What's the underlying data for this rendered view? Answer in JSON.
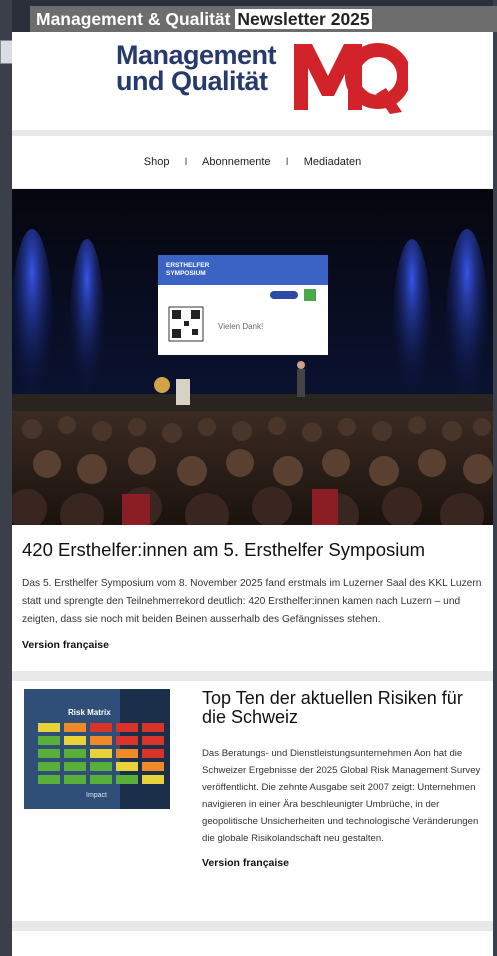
{
  "banner": {
    "title_part1": "Management & Qualität ",
    "title_part2": "Newsletter 2025"
  },
  "header": {
    "brand_line1": "Management",
    "brand_line2": "und Qualität",
    "logo_letters": "MQ"
  },
  "nav": {
    "items": [
      "Shop",
      "Abonnemente",
      "Mediadaten"
    ],
    "separator": "I"
  },
  "hero": {
    "screen_line1": "ERSTHELFER",
    "screen_line2": "SYMPOSIUM",
    "screen_thanks": "Vielen Dank!"
  },
  "article1": {
    "title": "420 Ersthelfer:innen am 5. Ersthelfer Symposium",
    "body": "Das 5. Ersthelfer Symposium vom 8. November 2025 fand erstmals im Luzerner Saal des KKL Luzern statt und sprengte den Teilnehmerrekord deutlich: 420 Ersthelfer:innen kamen nach Luzern – und zeigten, dass sie noch mit beiden Beinen ausserhalb des Gefängnisses stehen.",
    "link": "Version française"
  },
  "article2": {
    "title": "Top Ten der aktuellen Risiken für die Schweiz",
    "body": "Das Beratungs- und Dienstleistungsunternehmen Aon hat die Schweizer Ergebnisse der 2025 Global Risk Management Survey veröffentlicht. Die zehnte Ausgabe seit 2007 zeigt: Unternehmen navigieren in einer Ära beschleunigter Umbrüche, in der geopolitische Unsicherheiten und technologische Veränderungen die globale Risikolandschaft neu gestalten.",
    "link": "Version française",
    "thumb_title": "Risk Matrix",
    "thumb_axis": "Impact"
  }
}
